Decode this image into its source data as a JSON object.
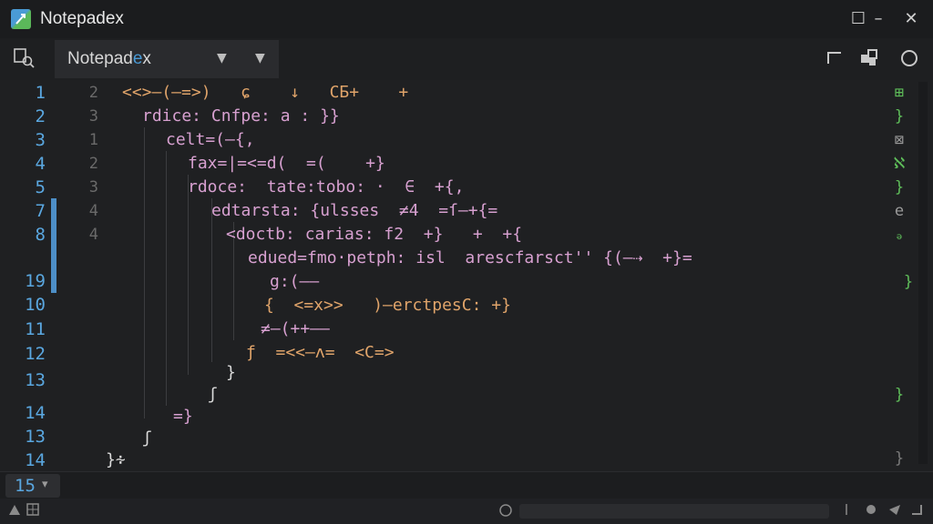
{
  "window": {
    "title": "Notepadex",
    "maximize_glyph": "☐",
    "minimize_glyph": "–",
    "close_glyph": "✕"
  },
  "toolbar": {
    "find_icon": "find-in-files-icon",
    "right_icons": [
      "corner-icon",
      "extension-icon",
      "circle-icon"
    ]
  },
  "tab": {
    "label_main": "Notepad",
    "label_accent": "e",
    "label_tail": "x",
    "dropdown_glyph": "▼"
  },
  "gutter": {
    "line_numbers": [
      "1",
      "2",
      "3",
      "4",
      "5",
      "7",
      "8",
      "19",
      "10",
      "11",
      "12",
      "13",
      "14",
      "13",
      "14"
    ],
    "secondary": [
      "2",
      "3",
      "1",
      "2",
      "3",
      "4",
      "4"
    ]
  },
  "code": [
    {
      "text": "<<>–(–=>)   ɕ    ↓   CБ+    +",
      "color": "orange"
    },
    {
      "text": "rdice: Cnfpe: a : }}",
      "color": "pink"
    },
    {
      "text": "celt=(–{,",
      "color": "pink"
    },
    {
      "text": "fax=|=<=d(  =(    +}",
      "color": "pink"
    },
    {
      "text": "rdoce:  tate:tobo: ·  ∈  +{,",
      "color": "pink"
    },
    {
      "text": "edtarsta: {ulsses  ≠4  =ſ–+{=",
      "color": "pink"
    },
    {
      "text": "<doctb: carias: f2  +}   +  +{",
      "color": "pink"
    },
    {
      "text": "edued=fmo·petph: isl  arescfarsct'' {(–⇢  +}=",
      "color": "pink"
    },
    {
      "text": "g:(–—",
      "color": "pink"
    },
    {
      "text": "{  <=x>>   )–erctpesC: +}",
      "color": "orange"
    },
    {
      "text": "≠–(++–—",
      "color": "pink"
    },
    {
      "text": "ƒ  =<<–ʌ=  <C=>",
      "color": "orange"
    },
    {
      "text": "}",
      "color": "white"
    },
    {
      "text": "ʃ",
      "color": "white"
    },
    {
      "text": "=}",
      "color": "pink"
    },
    {
      "text": "ʃ",
      "color": "white"
    },
    {
      "text": "}∻",
      "color": "white"
    }
  ],
  "right_markers": [
    "⊞",
    "}",
    "⊠",
    "ℵ",
    "}",
    "e",
    "ₔ",
    "}",
    "}",
    "}"
  ],
  "footer": {
    "current_line": "15",
    "caret_glyph": "▾",
    "left_icons": [
      "settings-icon",
      "grid-icon"
    ]
  },
  "colors": {
    "accent_blue": "#4a9bd6",
    "accent_green": "#5bb85a",
    "background": "#1e1f21"
  }
}
